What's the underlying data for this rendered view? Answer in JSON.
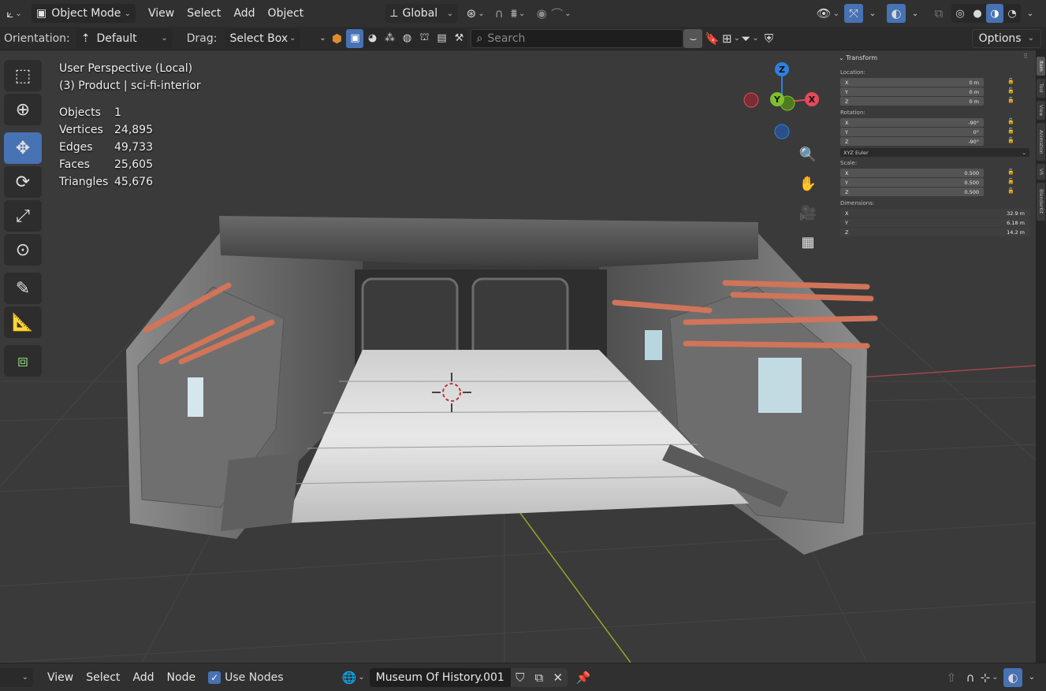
{
  "header": {
    "editor_type_icon": "axes-icon",
    "mode": "Object Mode",
    "menus": [
      "View",
      "Select",
      "Add",
      "Object"
    ],
    "transform_orientation": "Global",
    "options_label": "Options"
  },
  "tool_header": {
    "orientation_label": "Orientation:",
    "orientation_value": "Default",
    "drag_label": "Drag:",
    "drag_value": "Select Box",
    "search_placeholder": "Search"
  },
  "viewport": {
    "view_name": "User Perspective (Local)",
    "collection_line": "(3) Product | sci-fi-interior",
    "stats": [
      {
        "label": "Objects",
        "value": "1"
      },
      {
        "label": "Vertices",
        "value": "24,895"
      },
      {
        "label": "Edges",
        "value": "49,733"
      },
      {
        "label": "Faces",
        "value": "25,605"
      },
      {
        "label": "Triangles",
        "value": "45,676"
      }
    ],
    "gizmo": {
      "z": "Z",
      "y": "Y",
      "x": "X"
    },
    "colors": {
      "x_axis": "#e5495a",
      "y_axis": "#7fbf2f",
      "z_axis": "#2f7fe0",
      "active_tool": "#4772b3",
      "grid": "#4a4a4a"
    }
  },
  "npanel": {
    "title": "Transform",
    "location_label": "Location:",
    "location": [
      {
        "axis": "X",
        "value": "0 m"
      },
      {
        "axis": "Y",
        "value": "0 m"
      },
      {
        "axis": "Z",
        "value": "0 m"
      }
    ],
    "rotation_label": "Rotation:",
    "rotation": [
      {
        "axis": "X",
        "value": "-90°"
      },
      {
        "axis": "Y",
        "value": "0°"
      },
      {
        "axis": "Z",
        "value": "-90°"
      }
    ],
    "rotation_mode": "XYZ Euler",
    "scale_label": "Scale:",
    "scale": [
      {
        "axis": "X",
        "value": "0.500"
      },
      {
        "axis": "Y",
        "value": "0.500"
      },
      {
        "axis": "Z",
        "value": "0.500"
      }
    ],
    "dimensions_label": "Dimensions:",
    "dimensions": [
      {
        "axis": "X",
        "value": "32.9 m"
      },
      {
        "axis": "Y",
        "value": "6.18 m"
      },
      {
        "axis": "Z",
        "value": "14.2 m"
      }
    ],
    "tabs": [
      "Item",
      "Tool",
      "View",
      "Animation",
      "VR",
      "BlenderKit"
    ]
  },
  "bottom_bar": {
    "menus": [
      "View",
      "Select",
      "Add",
      "Node"
    ],
    "use_nodes_label": "Use Nodes",
    "material_name": "Museum Of History.001"
  }
}
